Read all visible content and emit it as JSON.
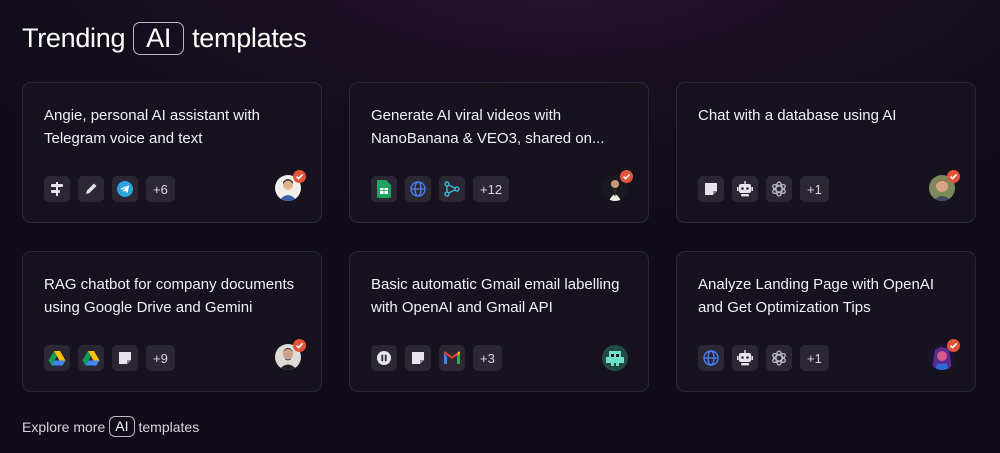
{
  "header": {
    "prefix": "Trending",
    "pill": "AI",
    "suffix": "templates"
  },
  "cards": [
    {
      "title": "Angie, personal AI assistant with Telegram voice and text",
      "more": "+6"
    },
    {
      "title": "Generate AI viral videos with NanoBanana & VEO3, shared on...",
      "more": "+12"
    },
    {
      "title": "Chat with a database using AI",
      "more": "+1"
    },
    {
      "title": "RAG chatbot for company documents using Google Drive and Gemini",
      "more": "+9"
    },
    {
      "title": "Basic automatic Gmail email labelling with OpenAI and Gmail API",
      "more": "+3"
    },
    {
      "title": "Analyze Landing Page with OpenAI and Get Optimization Tips",
      "more": "+1"
    }
  ],
  "footer": {
    "prefix": "Explore more",
    "pill": "AI",
    "suffix": "templates"
  },
  "colors": {
    "accent_badge": "#e2533a",
    "card_bg": "#16131e",
    "card_border": "#2c2837"
  }
}
